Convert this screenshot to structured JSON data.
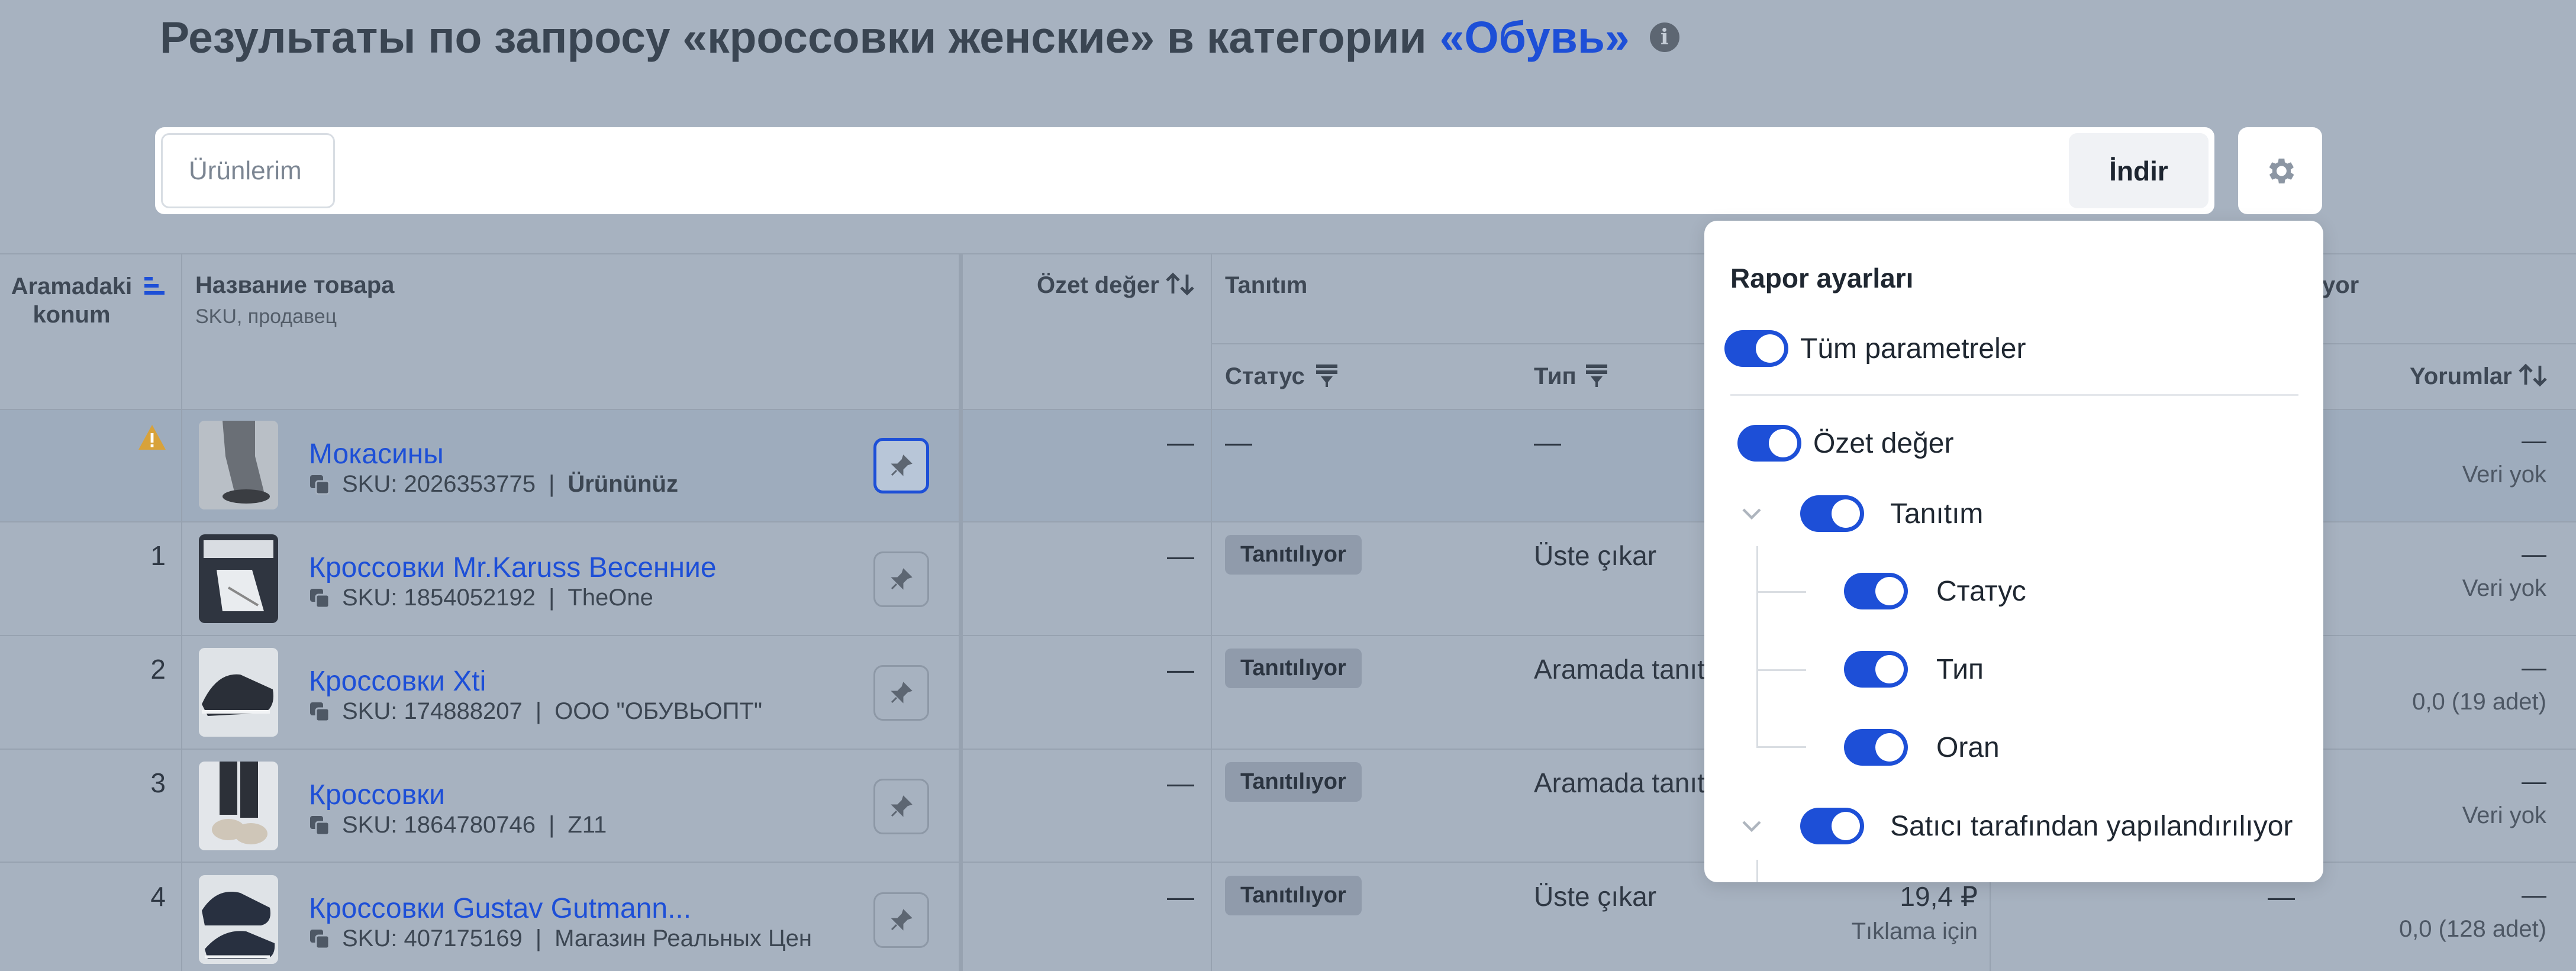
{
  "header": {
    "title": "Результаты по запросу «кроссовки женские» в категории",
    "category": "«Обувь»",
    "info_icon": "i"
  },
  "toolbar": {
    "search_placeholder": "Ürünlerim",
    "download_label": "İndir",
    "settings_icon": "gear-icon"
  },
  "table": {
    "headers": {
      "position": "Aramadaki konum",
      "product": "Название товара",
      "product_sub": "SKU, продавец",
      "summary": "Özet değer",
      "promotion": "Tanıtım",
      "status": "Статус",
      "type": "Тип",
      "seller_partial": "yor",
      "reviews": "Yorumlar"
    },
    "rows": [
      {
        "position": "",
        "warning": true,
        "name": "Мокасины",
        "sku": "SKU: 2026353775",
        "seller": "Ürününüz",
        "summary": "—",
        "status": "—",
        "type": "—",
        "price": "",
        "price_note": "",
        "rating": "",
        "reviews": "—",
        "reviews_sub": "Veri yok"
      },
      {
        "position": "1",
        "name": "Кроссовки Mr.Karuss Весенние",
        "sku": "SKU: 1854052192",
        "seller": "TheOne",
        "summary": "—",
        "status": "Tanıtılıyor",
        "type": "Üste çıkar",
        "price": "",
        "price_note": "",
        "rating": "",
        "reviews": "—",
        "reviews_sub": "Veri yok"
      },
      {
        "position": "2",
        "name": "Кроссовки Xti",
        "sku": "SKU: 174888207",
        "seller": "ООО \"ОБУВЬОПТ\"",
        "summary": "—",
        "status": "Tanıtılıyor",
        "type": "Aramada tanıt",
        "price": "",
        "price_note": "",
        "rating": "",
        "reviews": "—",
        "reviews_sub": "0,0 (19 adet)"
      },
      {
        "position": "3",
        "name": "Кроссовки",
        "sku": "SKU: 1864780746",
        "seller": "Z11",
        "summary": "—",
        "status": "Tanıtılıyor",
        "type": "Aramada tanıt",
        "price": "",
        "price_note": "",
        "rating": "",
        "reviews": "—",
        "reviews_sub": "Veri yok"
      },
      {
        "position": "4",
        "name": "Кроссовки Gustav Gutmann...",
        "sku": "SKU: 407175169",
        "seller": "Магазин Реальных Цен",
        "summary": "—",
        "status": "Tanıtılıyor",
        "type": "Üste çıkar",
        "price": "19,4 ₽",
        "price_note": "Tıklama için",
        "rating": "—",
        "reviews": "—",
        "reviews_sub": "0,0 (128 adet)"
      }
    ]
  },
  "settings_popup": {
    "title": "Rapor ayarları",
    "all_params": "Tüm parametreler",
    "summary": "Özet değer",
    "promotion": "Tanıtım",
    "status": "Статус",
    "type": "Тип",
    "rate": "Oran",
    "seller_configured": "Satıcı tarafından yapılandırılıyor"
  },
  "colors": {
    "accent": "#1d4fd7",
    "overlay_bg": "#a7b2c0",
    "badge_bg": "#909bab"
  }
}
